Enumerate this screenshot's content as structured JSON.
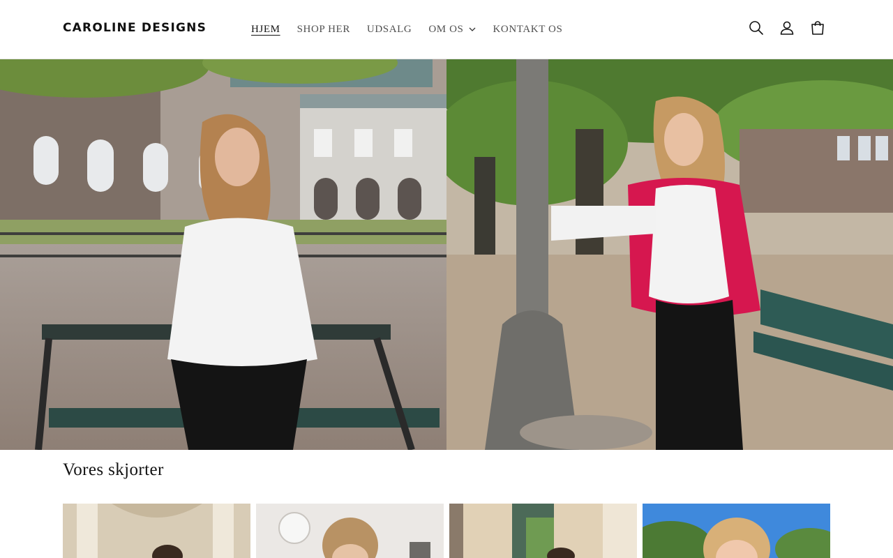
{
  "header": {
    "logo": "CAROLINE DESIGNS",
    "nav": [
      {
        "label": "HJEM",
        "active": true
      },
      {
        "label": "SHOP HER"
      },
      {
        "label": "UDSALG"
      },
      {
        "label": "OM OS",
        "has_dropdown": true
      },
      {
        "label": "KONTAKT OS"
      }
    ],
    "icons": [
      "search-icon",
      "account-icon",
      "cart-icon"
    ]
  },
  "hero": {
    "images": [
      "hero-image-left",
      "hero-image-right"
    ]
  },
  "collection": {
    "title": "Vores skjorter",
    "products": [
      "product-image-1",
      "product-image-2",
      "product-image-3",
      "product-image-4"
    ]
  }
}
